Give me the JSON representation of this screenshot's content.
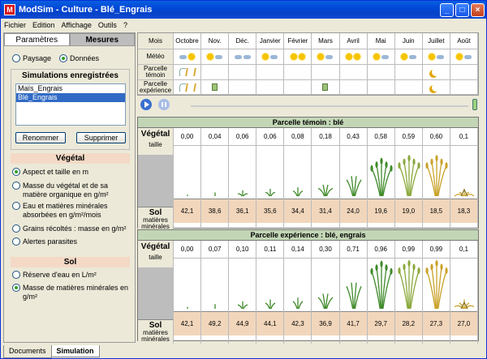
{
  "window": {
    "title": "ModSim - Culture - Blé_Engrais"
  },
  "menu": [
    "Fichier",
    "Edition",
    "Affichage",
    "Outils",
    "?"
  ],
  "left": {
    "tabs": [
      "Paramètres",
      "Mesures"
    ],
    "view": {
      "paysage": "Paysage",
      "donnees": "Données"
    },
    "simulations_title": "Simulations enregistrées",
    "simulations": [
      "Maïs_Engrais",
      "Blé_Engrais"
    ],
    "rename_label": "Renommer",
    "delete_label": "Supprimer",
    "vegetal_title": "Végétal",
    "vegetal_options": [
      "Aspect et taille en m",
      "Masse du végétal et de sa matière organique en g/m²",
      "Eau et matières minérales absorbées en g/m²/mois",
      "Grains récoltés : masse en g/m²",
      "Alertes parasites"
    ],
    "sol_title": "Sol",
    "sol_options": [
      "Réserve d'eau en L/m²",
      "Masse de matières minérales en g/m²"
    ]
  },
  "bottom_tabs": [
    "Documents",
    "Simulation"
  ],
  "calendar": {
    "header": "Mois",
    "months": [
      "Octobre",
      "Nov.",
      "Déc.",
      "Janvier",
      "Février",
      "Mars",
      "Avril",
      "Mai",
      "Juin",
      "Juillet",
      "Août"
    ],
    "row_labels": [
      "Météo",
      "Parcelle témoin",
      "Parcelle expérience"
    ],
    "meteo": [
      [
        "cloud",
        "sun"
      ],
      [
        "sun",
        "cloud"
      ],
      [
        "cloud",
        "cloud"
      ],
      [
        "sun",
        "cloud"
      ],
      [
        "sun",
        "sun"
      ],
      [
        "sun",
        "cloud"
      ],
      [
        "sun",
        "sun"
      ],
      [
        "sun",
        "cloud"
      ],
      [
        "sun",
        "cloud"
      ],
      [
        "sun",
        "cloud"
      ],
      [
        "sun",
        "cloud"
      ]
    ]
  },
  "parcel_temoin": {
    "title": "Parcelle témoin : blé",
    "veg_label": "Végétal",
    "taille_label": "taille",
    "taille": [
      "0,00",
      "0,04",
      "0,06",
      "0,06",
      "0,08",
      "0,18",
      "0,43",
      "0,58",
      "0,59",
      "0,60",
      "0,1"
    ],
    "sol_label": "Sol",
    "sol_sublabel": "matières minérales",
    "sol": [
      "42,1",
      "38,6",
      "36,1",
      "35,6",
      "34,4",
      "31,4",
      "24,0",
      "19,6",
      "19,0",
      "18,5",
      "18,3"
    ]
  },
  "parcel_experience": {
    "title": "Parcelle expérience : blé, engrais",
    "veg_label": "Végétal",
    "taille_label": "taille",
    "taille": [
      "0,00",
      "0,07",
      "0,10",
      "0,11",
      "0,14",
      "0,30",
      "0,71",
      "0,96",
      "0,99",
      "0,99",
      "0,1"
    ],
    "sol_label": "Sol",
    "sol_sublabel": "matières minérales",
    "sol": [
      "42,1",
      "49,2",
      "44,9",
      "44,1",
      "42,3",
      "36,9",
      "41,7",
      "29,7",
      "28,2",
      "27,3",
      "27,0"
    ]
  },
  "colors": {
    "titlebar": "#0048d8",
    "parcel_header": "#c2d6b5",
    "sol_cell": "#f1d6bb",
    "section_head": "#f3d9c6"
  }
}
